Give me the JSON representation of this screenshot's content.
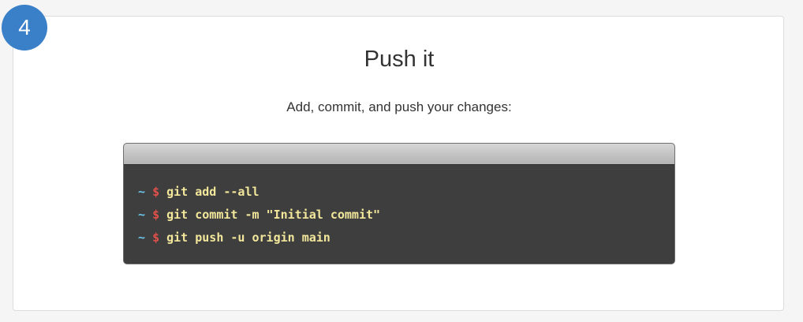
{
  "step": {
    "number": "4"
  },
  "section": {
    "title": "Push it",
    "subtitle": "Add, commit, and push your changes:"
  },
  "terminal": {
    "lines": [
      {
        "prompt_path": "~",
        "prompt_symbol": "$",
        "command": "git add --all"
      },
      {
        "prompt_path": "~",
        "prompt_symbol": "$",
        "command": "git commit -m \"Initial commit\""
      },
      {
        "prompt_path": "~",
        "prompt_symbol": "$",
        "command": "git push -u origin main"
      }
    ]
  },
  "colors": {
    "badge": "#3a80c9",
    "terminal_background": "#3e3e3e",
    "prompt_path": "#6cc4e8",
    "prompt_symbol": "#e0504a",
    "command_text": "#f3e79b"
  }
}
